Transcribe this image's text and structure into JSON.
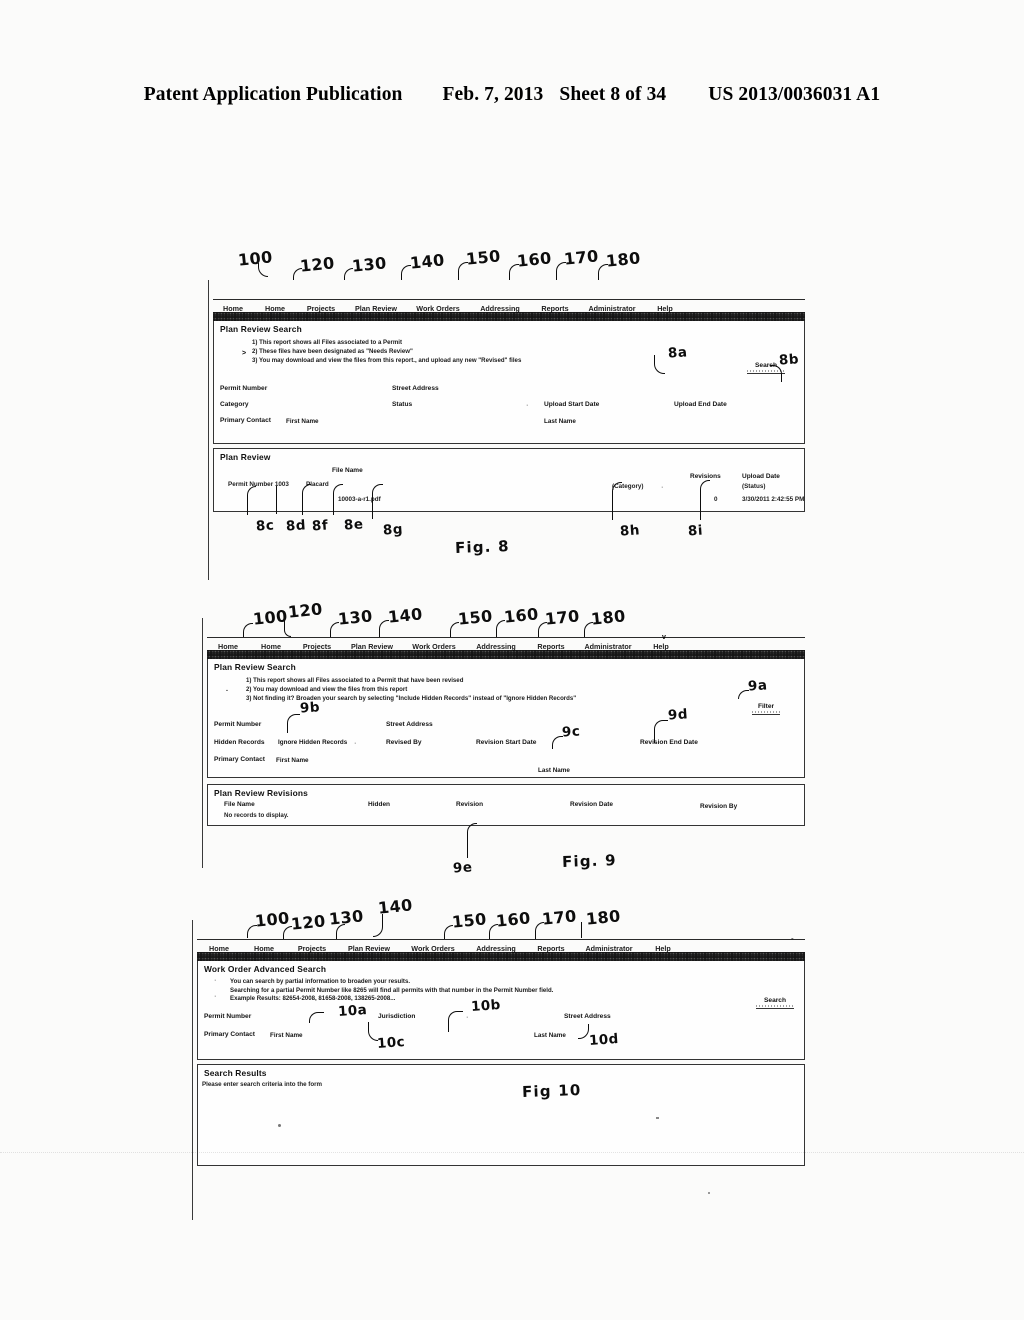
{
  "patent_header": {
    "publication": "Patent Application Publication",
    "date": "Feb. 7, 2013",
    "sheet": "Sheet 8 of 34",
    "number": "US 2013/0036031 A1"
  },
  "nav": {
    "items": [
      "Home",
      "Home",
      "Projects",
      "Plan Review",
      "Work Orders",
      "Addressing",
      "Reports",
      "Administrator",
      "Help"
    ],
    "callouts": [
      "100",
      "120",
      "130",
      "140",
      "150",
      "160",
      "170",
      "180"
    ]
  },
  "fig8": {
    "caption": "Fig. 8",
    "search_panel": {
      "title": "Plan Review Search",
      "bullets": [
        "1) This report shows all Files associated to a Permit",
        "2) These files have been designated as \"Needs Review\"",
        "3) You may download and view the files from this report., and upload any new \"Revised\" files"
      ],
      "fields": {
        "permit_number": "Permit Number",
        "street_address": "Street Address",
        "category": "Category",
        "status": "Status",
        "upload_start_date": "Upload Start Date",
        "upload_end_date": "Upload End Date",
        "primary_contact": "Primary Contact",
        "first_name": "First Name",
        "last_name": "Last Name"
      },
      "search_button": "Search"
    },
    "results_panel": {
      "title": "Plan Review",
      "columns": {
        "file_name": "File Name",
        "revisions": "Revisions",
        "upload_date": "Upload Date"
      },
      "row": {
        "permit_number": "Permit Number 1003",
        "placard": "Placard",
        "file": "10003-a-r1.pdf",
        "category": "(Category)",
        "status": "(Status)",
        "revisions": "0",
        "upload_date": "3/30/2011 2:42:55 PM"
      }
    },
    "callouts": [
      "8a",
      "8b",
      "8c",
      "8d",
      "8f",
      "8e",
      "8g",
      "8h",
      "8i"
    ]
  },
  "fig9": {
    "caption": "Fig. 9",
    "search_panel": {
      "title": "Plan Review Search",
      "bullets": [
        "1) This report shows all Files associated to a Permit that have been revised",
        "2) You may download and view the files from this report",
        "3) Not finding it? Broaden your search by selecting \"Include Hidden Records\" instead of \"Ignore Hidden Records\""
      ],
      "fields": {
        "permit_number": "Permit Number",
        "street_address": "Street Address",
        "hidden_records": "Hidden Records",
        "hidden_records_value": "Ignore Hidden Records",
        "revised_by": "Revised By",
        "revision_start_date": "Revision Start Date",
        "revision_end_date": "Revision End Date",
        "primary_contact": "Primary Contact",
        "first_name": "First Name",
        "last_name": "Last Name"
      },
      "filter_button": "Filter"
    },
    "results_panel": {
      "title": "Plan Review Revisions",
      "columns": [
        "File Name",
        "Hidden",
        "Revision",
        "Revision Date",
        "Revision By"
      ],
      "empty_message": "No records to display."
    },
    "callouts": [
      "9a",
      "9b",
      "9c",
      "9d",
      "9e"
    ]
  },
  "fig10": {
    "caption": "Fig 10",
    "search_panel": {
      "title": "Work Order Advanced Search",
      "bullets": [
        "You can search by partial information to broaden your results.",
        "Searching for a partial Permit Number like 8265 will find all permits with that number in the Permit Number field.",
        "Example Results: 82654-2008, 81658-2008, 138265-2008..."
      ],
      "fields": {
        "permit_number": "Permit Number",
        "jurisdiction": "Jurisdiction",
        "street_address": "Street Address",
        "primary_contact": "Primary Contact",
        "first_name": "First Name",
        "last_name": "Last Name"
      },
      "search_button": "Search"
    },
    "results_panel": {
      "title": "Search Results",
      "empty_message": "Please enter search criteria into the form"
    },
    "callouts": [
      "10a",
      "10b",
      "10c",
      "10d"
    ]
  }
}
